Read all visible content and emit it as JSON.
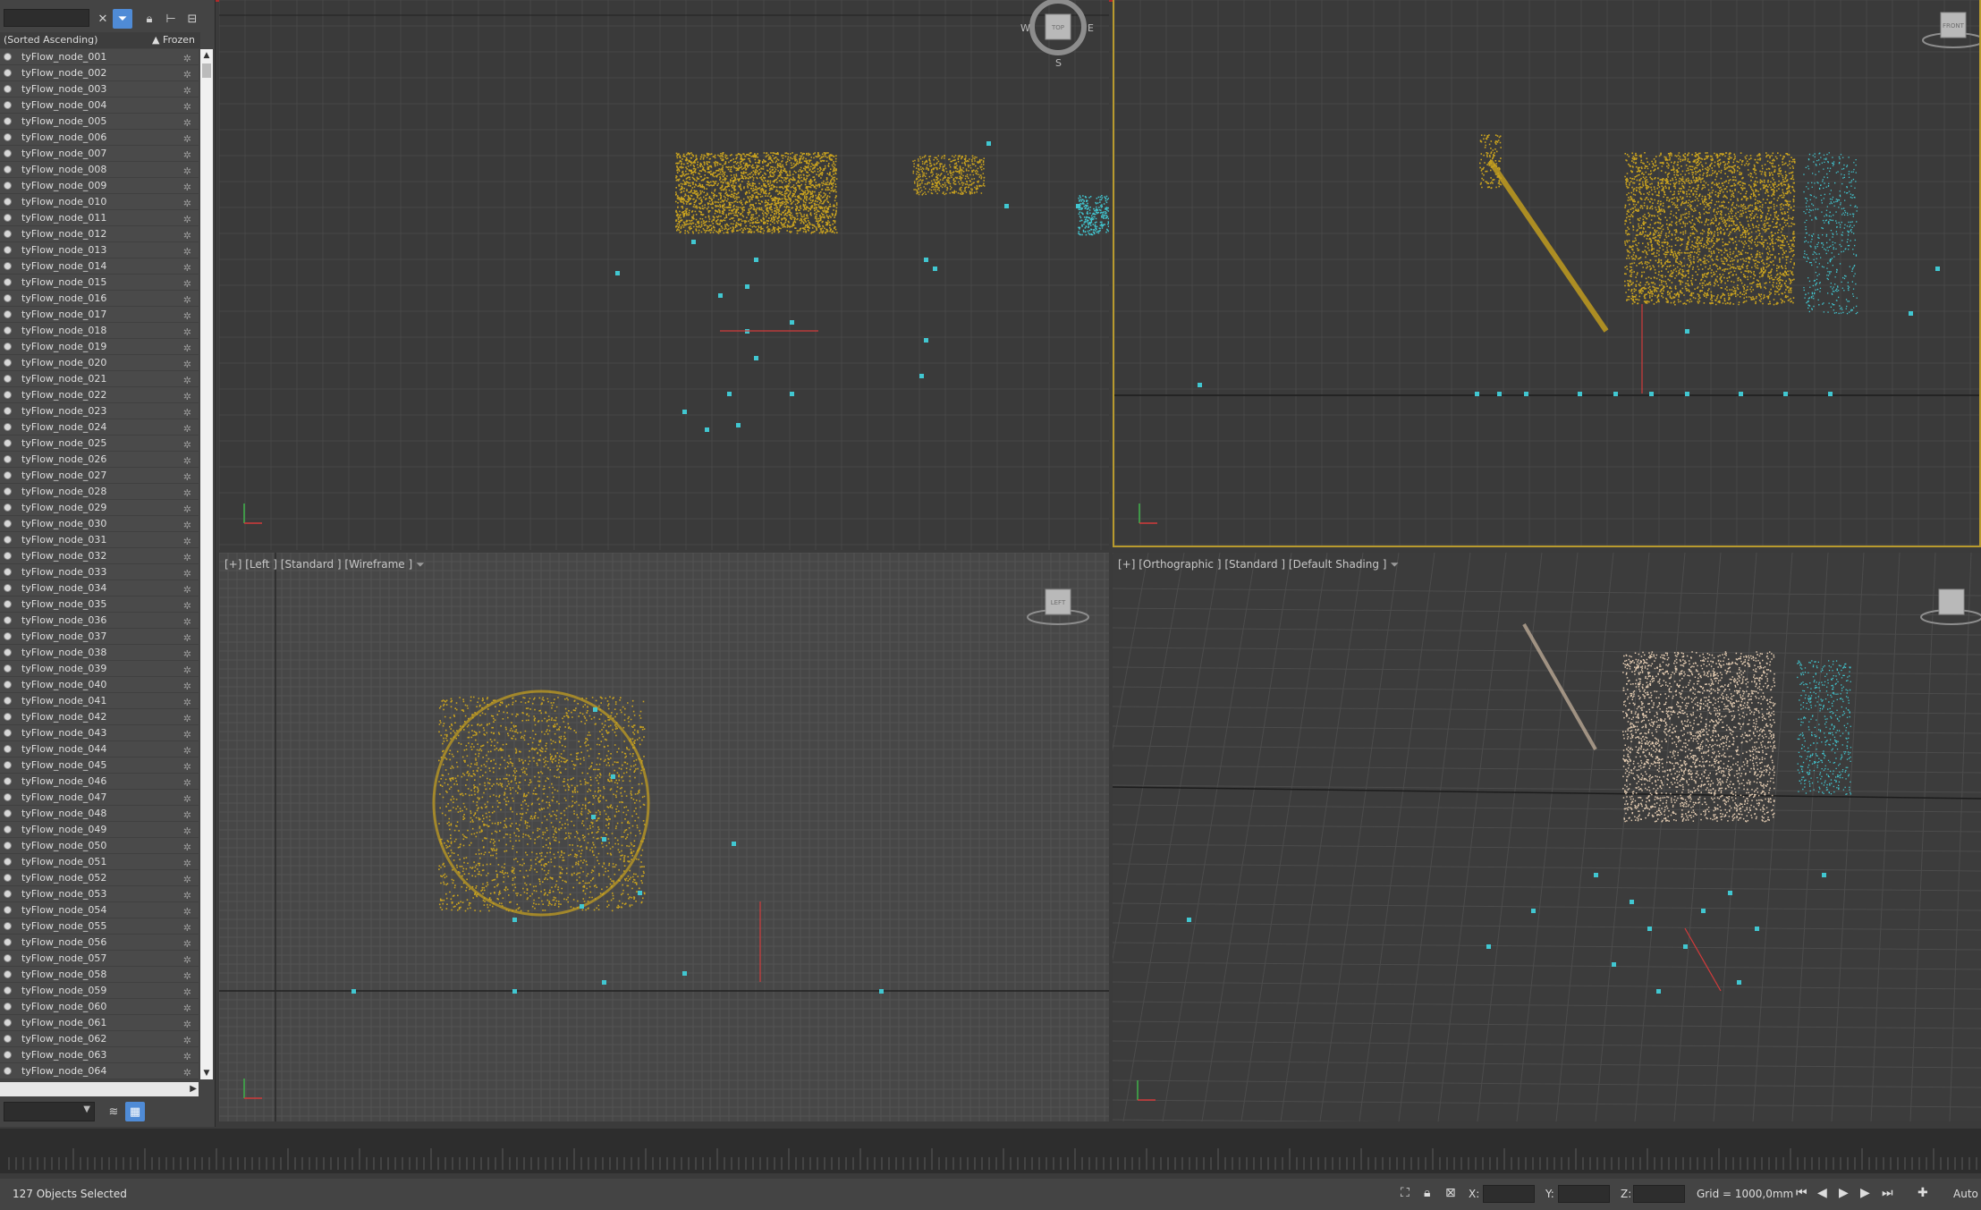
{
  "explorer": {
    "sort_label": "(Sorted Ascending)",
    "frozen_label": "▲ Frozen",
    "nodes": [
      "tyFlow_node_001",
      "tyFlow_node_002",
      "tyFlow_node_003",
      "tyFlow_node_004",
      "tyFlow_node_005",
      "tyFlow_node_006",
      "tyFlow_node_007",
      "tyFlow_node_008",
      "tyFlow_node_009",
      "tyFlow_node_010",
      "tyFlow_node_011",
      "tyFlow_node_012",
      "tyFlow_node_013",
      "tyFlow_node_014",
      "tyFlow_node_015",
      "tyFlow_node_016",
      "tyFlow_node_017",
      "tyFlow_node_018",
      "tyFlow_node_019",
      "tyFlow_node_020",
      "tyFlow_node_021",
      "tyFlow_node_022",
      "tyFlow_node_023",
      "tyFlow_node_024",
      "tyFlow_node_025",
      "tyFlow_node_026",
      "tyFlow_node_027",
      "tyFlow_node_028",
      "tyFlow_node_029",
      "tyFlow_node_030",
      "tyFlow_node_031",
      "tyFlow_node_032",
      "tyFlow_node_033",
      "tyFlow_node_034",
      "tyFlow_node_035",
      "tyFlow_node_036",
      "tyFlow_node_037",
      "tyFlow_node_038",
      "tyFlow_node_039",
      "tyFlow_node_040",
      "tyFlow_node_041",
      "tyFlow_node_042",
      "tyFlow_node_043",
      "tyFlow_node_044",
      "tyFlow_node_045",
      "tyFlow_node_046",
      "tyFlow_node_047",
      "tyFlow_node_048",
      "tyFlow_node_049",
      "tyFlow_node_050",
      "tyFlow_node_051",
      "tyFlow_node_052",
      "tyFlow_node_053",
      "tyFlow_node_054",
      "tyFlow_node_055",
      "tyFlow_node_056",
      "tyFlow_node_057",
      "tyFlow_node_058",
      "tyFlow_node_059",
      "tyFlow_node_060",
      "tyFlow_node_061",
      "tyFlow_node_062",
      "tyFlow_node_063",
      "tyFlow_node_064"
    ],
    "toolbar_icons": [
      "clear-icon",
      "filter-icon",
      "lock-icon",
      "hierarchy-icon",
      "layers-icon"
    ]
  },
  "viewports": {
    "top": {
      "label": ""
    },
    "front": {
      "label": ""
    },
    "left": {
      "label": "[+] [Left ] [Standard ] [Wireframe ]"
    },
    "perspective": {
      "label": "[+] [Orthographic ] [Standard ] [Default Shading ]"
    }
  },
  "viewcube": {
    "top_face": "TOP",
    "west": "W",
    "east": "E",
    "south": "S",
    "front_face": "FRONT",
    "left_face": "LEFT"
  },
  "status": {
    "selection": "127 Objects Selected",
    "x_label": "X:",
    "y_label": "Y:",
    "z_label": "Z:",
    "grid": "Grid = 1000,0mm",
    "auto_label": "Auto"
  },
  "colors": {
    "particles": "#c9a21e",
    "helpers": "#41c7d1",
    "active_border": "#b89a2e",
    "selection_blue": "#4f8bd6"
  }
}
